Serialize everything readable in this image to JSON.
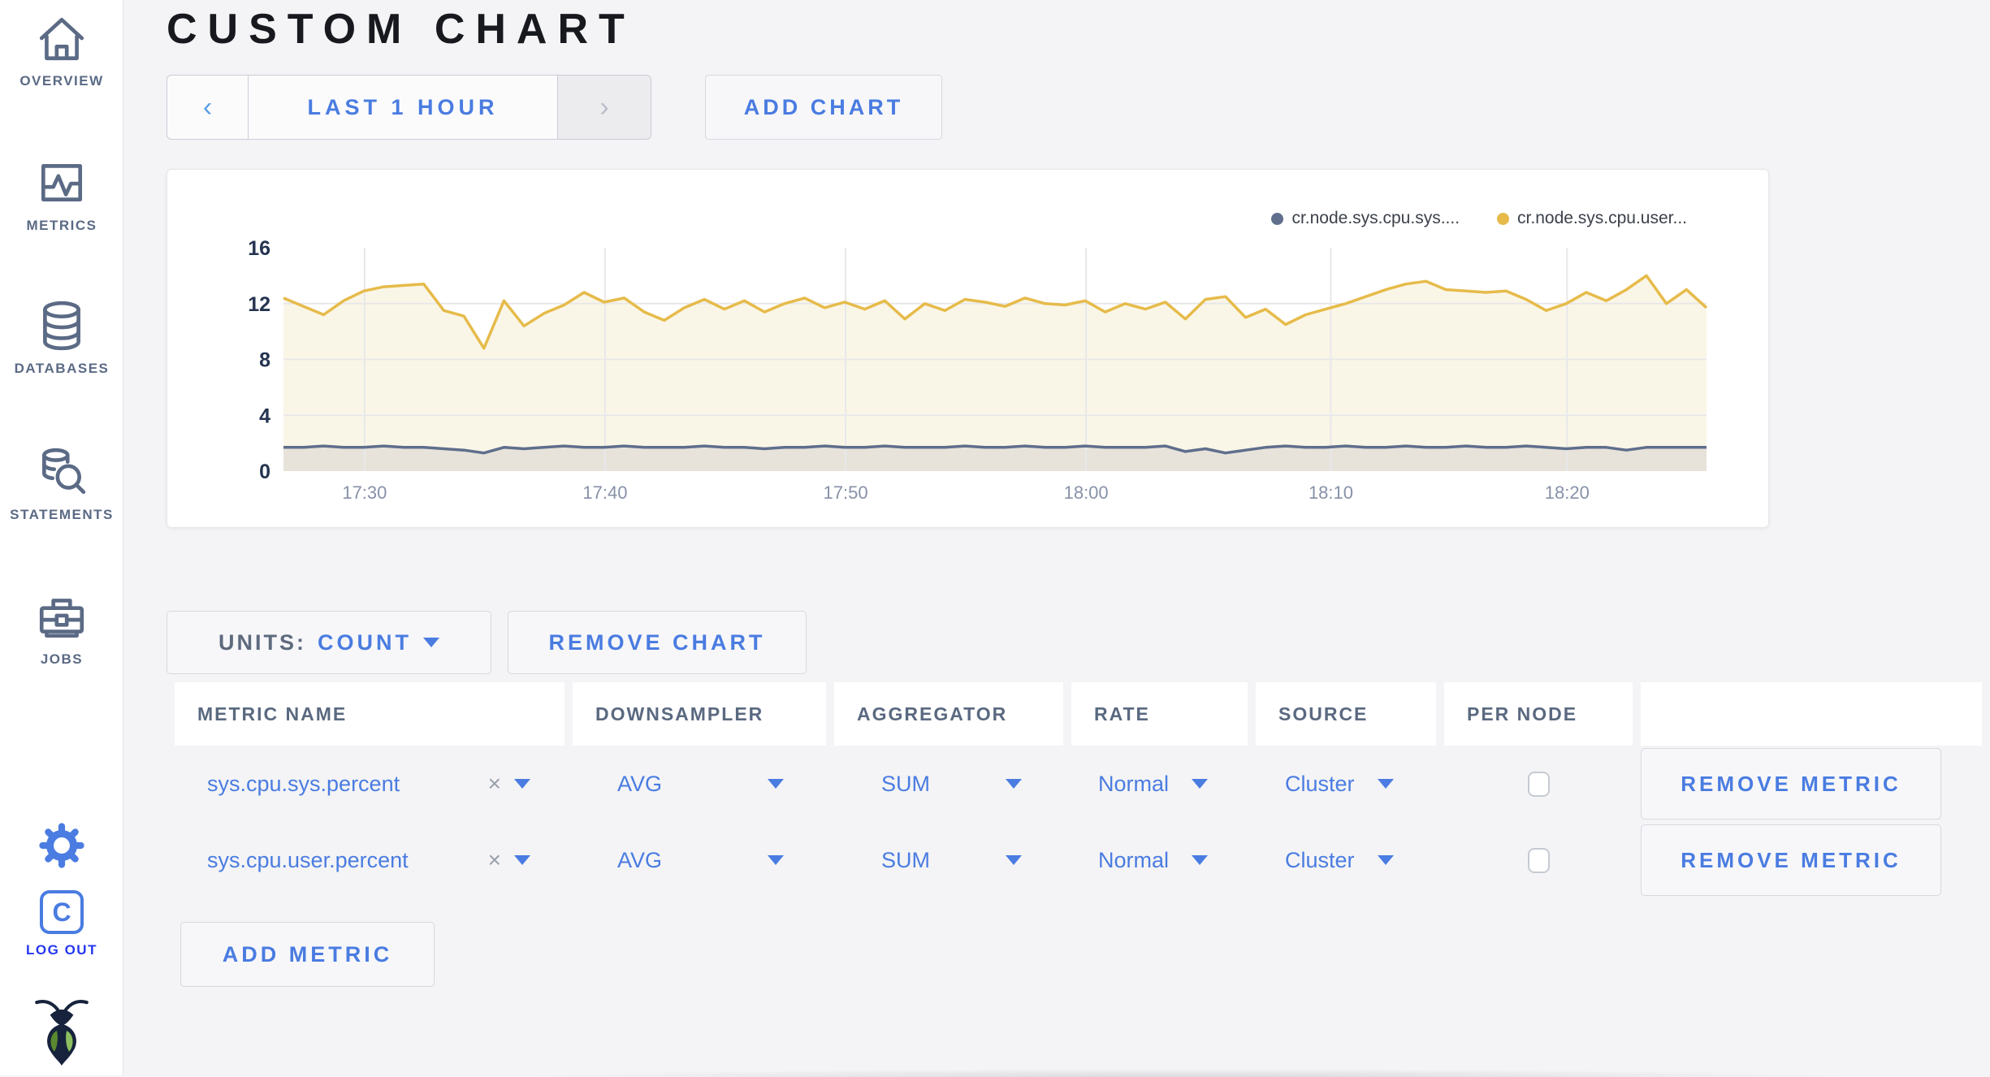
{
  "page": {
    "title": "CUSTOM CHART"
  },
  "sidebar": {
    "items": [
      {
        "label": "OVERVIEW",
        "icon": "home-icon"
      },
      {
        "label": "METRICS",
        "icon": "metrics-icon"
      },
      {
        "label": "DATABASES",
        "icon": "database-icon"
      },
      {
        "label": "STATEMENTS",
        "icon": "statements-icon"
      },
      {
        "label": "JOBS",
        "icon": "jobs-icon"
      }
    ],
    "settings_icon": "gear-icon",
    "logout": {
      "label": "LOG OUT",
      "icon": "cockroach-c-icon"
    },
    "brand_icon": "cockroach-logo"
  },
  "toolbar": {
    "prev_arrow": "‹",
    "time_range": "LAST 1 HOUR",
    "next_arrow": "›",
    "add_chart": "ADD CHART"
  },
  "chart_data": {
    "type": "line",
    "title": "",
    "xlabel": "",
    "ylabel": "",
    "ylim": [
      0,
      16
    ],
    "yticks": [
      0,
      4,
      8,
      12,
      16
    ],
    "grid": true,
    "legend_position": "top-right",
    "xticks": [
      {
        "label": "17:30",
        "frac": 0.057
      },
      {
        "label": "17:40",
        "frac": 0.226
      },
      {
        "label": "17:50",
        "frac": 0.395
      },
      {
        "label": "18:00",
        "frac": 0.564
      },
      {
        "label": "18:10",
        "frac": 0.736
      },
      {
        "label": "18:20",
        "frac": 0.902
      }
    ],
    "series": [
      {
        "name": "cr.node.sys.cpu.sys....",
        "color": "#5f6e8c",
        "fill": "#e7e3da",
        "values": [
          1.7,
          1.7,
          1.8,
          1.7,
          1.7,
          1.8,
          1.7,
          1.7,
          1.6,
          1.5,
          1.3,
          1.7,
          1.6,
          1.7,
          1.8,
          1.7,
          1.7,
          1.8,
          1.7,
          1.7,
          1.7,
          1.8,
          1.7,
          1.7,
          1.6,
          1.7,
          1.7,
          1.8,
          1.7,
          1.7,
          1.8,
          1.7,
          1.7,
          1.7,
          1.8,
          1.7,
          1.7,
          1.8,
          1.7,
          1.7,
          1.8,
          1.7,
          1.7,
          1.7,
          1.8,
          1.4,
          1.6,
          1.3,
          1.5,
          1.7,
          1.8,
          1.7,
          1.7,
          1.8,
          1.7,
          1.7,
          1.8,
          1.7,
          1.7,
          1.8,
          1.7,
          1.7,
          1.8,
          1.7,
          1.6,
          1.7,
          1.7,
          1.5,
          1.7,
          1.7,
          1.7,
          1.7
        ]
      },
      {
        "name": "cr.node.sys.cpu.user...",
        "color": "#e6bb4a",
        "fill": "#faf6e7",
        "values": [
          12.4,
          11.8,
          11.2,
          12.2,
          12.9,
          13.2,
          13.3,
          13.4,
          11.5,
          11.1,
          8.8,
          12.2,
          10.4,
          11.3,
          11.9,
          12.8,
          12.1,
          12.4,
          11.4,
          10.8,
          11.7,
          12.3,
          11.6,
          12.2,
          11.4,
          12.0,
          12.4,
          11.7,
          12.1,
          11.6,
          12.2,
          10.9,
          12.0,
          11.5,
          12.3,
          12.1,
          11.8,
          12.4,
          12.0,
          11.9,
          12.2,
          11.4,
          12.0,
          11.6,
          12.1,
          10.9,
          12.3,
          12.5,
          11.0,
          11.6,
          10.5,
          11.2,
          11.6,
          12.0,
          12.5,
          13.0,
          13.4,
          13.6,
          13.0,
          12.9,
          12.8,
          12.9,
          12.3,
          11.5,
          12.0,
          12.8,
          12.2,
          13.0,
          14.0,
          12.0,
          13.0,
          11.7
        ]
      }
    ]
  },
  "controls": {
    "units_label": "UNITS:",
    "units_value": "COUNT",
    "remove_chart": "REMOVE CHART",
    "add_metric": "ADD METRIC",
    "remove_metric": "REMOVE METRIC"
  },
  "metrics_table": {
    "headers": [
      "METRIC NAME",
      "DOWNSAMPLER",
      "AGGREGATOR",
      "RATE",
      "SOURCE",
      "PER NODE",
      ""
    ],
    "rows": [
      {
        "name": "sys.cpu.sys.percent",
        "clear": "×",
        "downsampler": "AVG",
        "aggregator": "SUM",
        "rate": "Normal",
        "source": "Cluster",
        "per_node": false
      },
      {
        "name": "sys.cpu.user.percent",
        "clear": "×",
        "downsampler": "AVG",
        "aggregator": "SUM",
        "rate": "Normal",
        "source": "Cluster",
        "per_node": false
      }
    ]
  },
  "colors": {
    "accent_blue": "#4a7ce1",
    "slate": "#5b6a85",
    "logout_blue": "#2637f0"
  }
}
